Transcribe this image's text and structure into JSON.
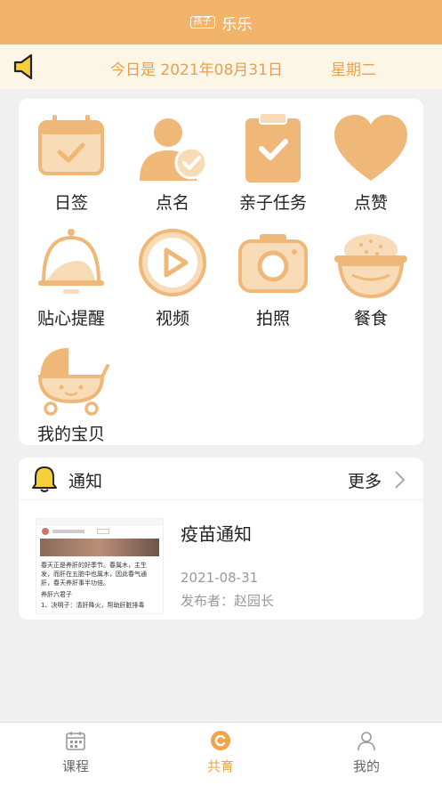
{
  "app": {
    "title": "乐乐",
    "badge": "孩子"
  },
  "datebar": {
    "date_text": "今日是 2021年08月31日",
    "weekday": "星期二"
  },
  "grid": {
    "items": [
      {
        "label": "日签",
        "icon": "calendar-check-icon"
      },
      {
        "label": "点名",
        "icon": "person-check-icon"
      },
      {
        "label": "亲子任务",
        "icon": "clipboard-check-icon"
      },
      {
        "label": "点赞",
        "icon": "heart-icon"
      },
      {
        "label": "贴心提醒",
        "icon": "bell-reminder-icon"
      },
      {
        "label": "视频",
        "icon": "play-icon"
      },
      {
        "label": "拍照",
        "icon": "camera-icon"
      },
      {
        "label": "餐食",
        "icon": "rice-bowl-icon"
      },
      {
        "label": "我的宝贝",
        "icon": "baby-stroller-icon"
      }
    ]
  },
  "notice": {
    "title": "通知",
    "more": "更多",
    "item": {
      "title": "疫苗通知",
      "date": "2021-08-31",
      "publisher": "发布者：赵园长",
      "thumb_lines": [
        "春天正是养肝的好季节。春属木，主生发，而肝在五脏中也属木，因此春气通肝，春天养肝事半功倍。",
        "养肝六君子",
        "1、决明子：清肝降火，帮助肝脏排毒"
      ]
    }
  },
  "tabbar": {
    "tabs": [
      {
        "label": "课程",
        "icon": "calendar-grid-icon"
      },
      {
        "label": "共育",
        "icon": "circle-c-icon",
        "active": true
      },
      {
        "label": "我的",
        "icon": "user-icon"
      }
    ]
  },
  "colors": {
    "accent": "#f2b36a",
    "icon_fill": "#f0b878",
    "icon_light": "#f8dcb8",
    "active_tab": "#f0a549"
  }
}
